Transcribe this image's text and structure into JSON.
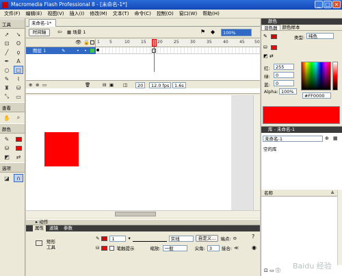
{
  "window": {
    "title": "Macromedia Flash Professional 8 - [未命名-1*]",
    "controls": [
      "_",
      "□",
      "×"
    ]
  },
  "menu": [
    "文件(F)",
    "编辑(E)",
    "视图(V)",
    "插入(I)",
    "修改(M)",
    "文本(T)",
    "命令(C)",
    "控制(O)",
    "窗口(W)",
    "帮助(H)"
  ],
  "toolbox": {
    "title": "工具",
    "view_label": "查看",
    "colors_label": "颜色",
    "options_label": "选项"
  },
  "document": {
    "tab": "未命名-1*",
    "timeline_button": "时间轴",
    "scene": "场景 1",
    "zoom": "100%"
  },
  "timeline": {
    "ruler": [
      "1",
      "5",
      "10",
      "15",
      "20",
      "25",
      "30",
      "35",
      "40",
      "45",
      "50"
    ],
    "layer_name": "图层 1",
    "current_frame": "20",
    "fps": "12.0 fps",
    "elapsed": "1.6s"
  },
  "stage": {
    "rect_color": "#ff0000"
  },
  "actions": {
    "label": "动作"
  },
  "properties": {
    "tabs": [
      "属性",
      "滤镜",
      "参数"
    ],
    "tool_type_line1": "矩形",
    "tool_type_line2": "工具",
    "stroke_width": "1",
    "stroke_style": "实线",
    "custom_button": "自定义...",
    "endpoint_label": "端点:",
    "hinting_label": "笔触提示",
    "scale_label": "缩放:",
    "scale_value": "一般",
    "miter_label": "尖角:",
    "miter_value": "3",
    "join_label": "接合:"
  },
  "color_panel": {
    "title": "颜色",
    "tabs": [
      "混色器",
      "颜色样本"
    ],
    "type_label": "类型:",
    "type_value": "纯色",
    "red_label": "红:",
    "red_value": "255",
    "green_label": "绿:",
    "green_value": "0",
    "blue_label": "蓝:",
    "blue_value": "0",
    "alpha_label": "Alpha:",
    "alpha_value": "100%",
    "hex_value": "#FF0000",
    "current_color": "#ff0000"
  },
  "library_panel": {
    "title": "库 - 未命名-1",
    "document_select": "未命名-1",
    "empty_label": "空的库",
    "column_name": "名称"
  },
  "watermark": "Baidu 经验"
}
